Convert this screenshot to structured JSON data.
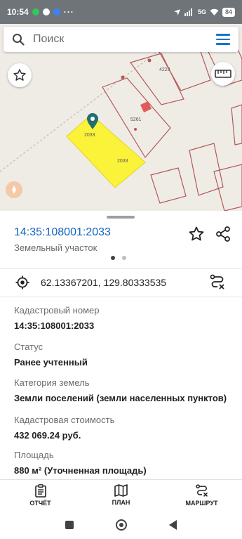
{
  "status_bar": {
    "time": "10:54",
    "network": "5G",
    "battery": "84",
    "more": "···"
  },
  "search": {
    "placeholder": "Поиск"
  },
  "map": {
    "labels": [
      "4223",
      "5261",
      "2033",
      "2033"
    ],
    "highlight_color": "#fbf23a",
    "parcel_line_color": "#b5585a",
    "marker_color": "#1f6f73"
  },
  "parcel": {
    "number": "14:35:108001:2033",
    "type": "Земельный участок",
    "coordinates": "62.13367201, 129.80333535",
    "pager": {
      "count": 2,
      "active": 1
    }
  },
  "fields": [
    {
      "label": "Кадастровый номер",
      "value": "14:35:108001:2033"
    },
    {
      "label": "Статус",
      "value": "Ранее учтенный"
    },
    {
      "label": "Категория земель",
      "value": "Земли поселений (земли населенных пунктов)"
    },
    {
      "label": "Кадастровая стоимость",
      "value": "432 069.24 руб."
    },
    {
      "label": "Площадь",
      "value": "880 м² (Уточненная площадь)"
    }
  ],
  "bottom_nav": [
    {
      "label": "ОТЧЁТ",
      "icon": "report-icon"
    },
    {
      "label": "ПЛАН",
      "icon": "map-plan-icon"
    },
    {
      "label": "МАРШРУТ",
      "icon": "route-icon"
    }
  ],
  "accent_color": "#1565c0"
}
